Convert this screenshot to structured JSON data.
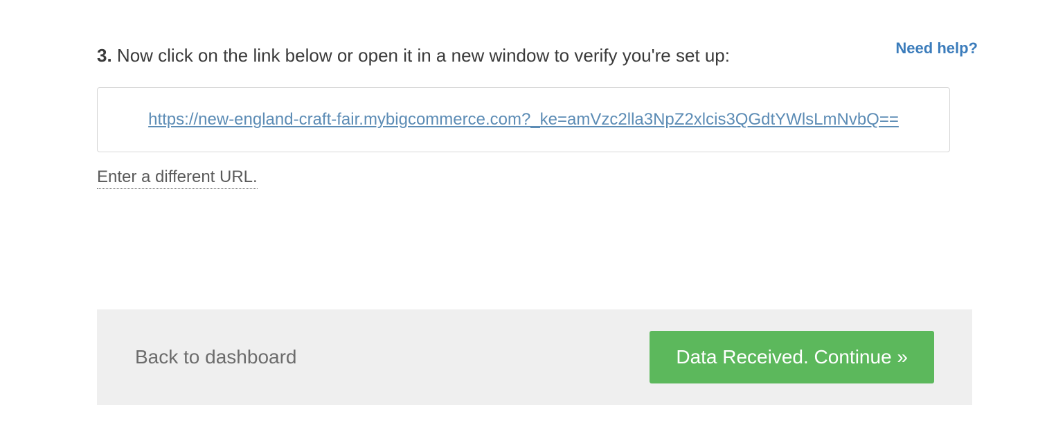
{
  "top_help_fragment": "Need help?",
  "step": {
    "number": "3.",
    "text": "Now click on the link below or open it in a new window to verify you're set up:"
  },
  "verify_url": "https://new-england-craft-fair.mybigcommerce.com?_ke=amVzc2lla3NpZ2xlcis3QGdtYWlsLmNvbQ==",
  "different_url_label": "Enter a different URL.",
  "footer": {
    "back_label": "Back to dashboard",
    "continue_label": "Data Received. Continue »"
  }
}
